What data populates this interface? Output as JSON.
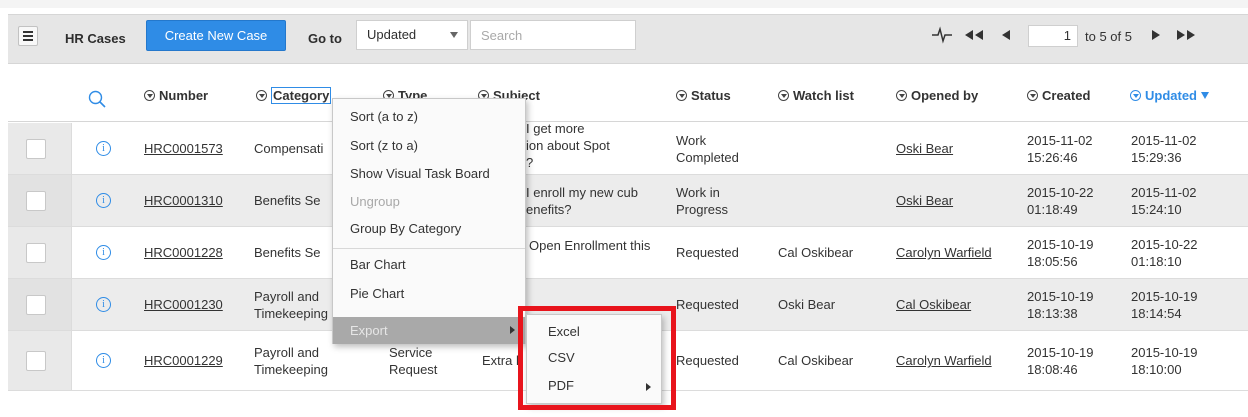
{
  "header": {
    "title": "HR Cases",
    "create_button": "Create New Case",
    "goto_label": "Go to",
    "goto_selected": "Updated",
    "search_placeholder": "Search",
    "page_current": "1",
    "page_total_text": "to 5 of 5"
  },
  "columns": {
    "number": "Number",
    "category": "Category",
    "type": "Type",
    "subject": "Subject",
    "status": "Status",
    "watch_list": "Watch list",
    "opened_by": "Opened by",
    "created": "Created",
    "updated": "Updated"
  },
  "rows": [
    {
      "number": "HRC0001573",
      "category": "Compensati",
      "subject_l1": "I get more",
      "subject_l2": "ion about Spot",
      "subject_l3": "?",
      "status_l1": "Work",
      "status_l2": "Completed",
      "watch_list": "",
      "opened_by": "Oski Bear",
      "created_date": "2015-11-02",
      "created_time": "15:26:46",
      "updated_date": "2015-11-02",
      "updated_time": "15:29:36"
    },
    {
      "number": "HRC0001310",
      "category": "Benefits Se",
      "subject_l1": "I enroll my new cub",
      "subject_l2": "enefits?",
      "status_l1": "Work in",
      "status_l2": "Progress",
      "watch_list": "",
      "opened_by": "Oski Bear",
      "created_date": "2015-10-22",
      "created_time": "01:18:49",
      "updated_date": "2015-11-02",
      "updated_time": "15:24:10"
    },
    {
      "number": "HRC0001228",
      "category": "Benefits Se",
      "subject_l1": "Open Enrollment this",
      "status": "Requested",
      "watch_list": "Cal Oskibear",
      "opened_by": "Carolyn Warfield",
      "created_date": "2015-10-19",
      "created_time": "18:05:56",
      "updated_date": "2015-10-22",
      "updated_time": "01:18:10"
    },
    {
      "number": "HRC0001230",
      "category_l1": "Payroll and",
      "category_l2": "Timekeeping",
      "status": "Requested",
      "watch_list": "Oski Bear",
      "opened_by": "Cal Oskibear",
      "created_date": "2015-10-19",
      "created_time": "18:13:38",
      "updated_date": "2015-10-19",
      "updated_time": "18:14:54"
    },
    {
      "number": "HRC0001229",
      "category_l1": "Payroll and",
      "category_l2": "Timekeeping",
      "type_l1": "Service",
      "type_l2": "Request",
      "subject_l1": "Extra h",
      "status": "Requested",
      "watch_list": "Cal Oskibear",
      "opened_by": "Carolyn Warfield",
      "created_date": "2015-10-19",
      "created_time": "18:08:46",
      "updated_date": "2015-10-19",
      "updated_time": "18:10:00"
    }
  ],
  "context_menu": {
    "sort_az": "Sort (a to z)",
    "sort_za": "Sort (z to a)",
    "visual_board": "Show Visual Task Board",
    "ungroup": "Ungroup",
    "group_by": "Group By Category",
    "bar_chart": "Bar Chart",
    "pie_chart": "Pie Chart",
    "export": "Export"
  },
  "export_menu": {
    "excel": "Excel",
    "csv": "CSV",
    "pdf": "PDF"
  },
  "colors": {
    "accent": "#2f8ce6",
    "highlight": "#e8141c"
  }
}
